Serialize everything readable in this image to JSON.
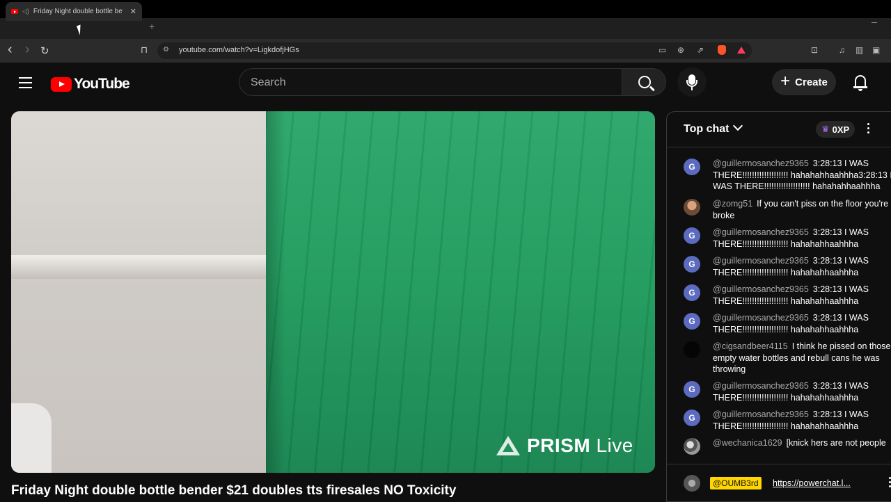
{
  "browser": {
    "tab": {
      "title": "Friday Night double bottle be",
      "close": "✕"
    },
    "new_tab": "+",
    "url": "youtube.com/watch?v=LigkdofjHGs",
    "back": "‹",
    "forward": "›",
    "reload": "↻",
    "bookmark": "⌑"
  },
  "header": {
    "logo_text": "YouTube",
    "search_placeholder": "Search",
    "create_label": "Create",
    "create_plus": "+"
  },
  "video": {
    "title": "Friday Night double bottle bender $21 doubles tts firesales NO Toxicity",
    "watermark_bold": "PRISM",
    "watermark_light": " Live"
  },
  "chat": {
    "title": "Top chat",
    "xp": "0XP",
    "messages": [
      {
        "initial": "G",
        "author": "@guillermosanchez9365",
        "text": "3:28:13 I WAS THERE!!!!!!!!!!!!!!!!!!! hahahahhaahhha3:28:13 I WAS THERE!!!!!!!!!!!!!!!!!!! hahahahhaahhha"
      },
      {
        "initial": "",
        "author": "@zomg51",
        "text": "If you can't piss on the floor you're broke"
      },
      {
        "initial": "G",
        "author": "@guillermosanchez9365",
        "text": "3:28:13 I WAS THERE!!!!!!!!!!!!!!!!!!! hahahahhaahhha"
      },
      {
        "initial": "G",
        "author": "@guillermosanchez9365",
        "text": "3:28:13 I WAS THERE!!!!!!!!!!!!!!!!!!! hahahahhaahhha"
      },
      {
        "initial": "G",
        "author": "@guillermosanchez9365",
        "text": "3:28:13 I WAS THERE!!!!!!!!!!!!!!!!!!! hahahahhaahhha"
      },
      {
        "initial": "G",
        "author": "@guillermosanchez9365",
        "text": "3:28:13 I WAS THERE!!!!!!!!!!!!!!!!!!! hahahahhaahhha"
      },
      {
        "initial": "",
        "author": "@cigsandbeer4115",
        "text": "I think he pissed on those empty water bottles and rebull cans he was throwing"
      },
      {
        "initial": "G",
        "author": "@guillermosanchez9365",
        "text": "3:28:13 I WAS THERE!!!!!!!!!!!!!!!!!!! hahahahhaahhha"
      },
      {
        "initial": "G",
        "author": "@guillermosanchez9365",
        "text": "3:28:13 I WAS THERE!!!!!!!!!!!!!!!!!!! hahahahhaahhha"
      },
      {
        "initial": "",
        "author": "@wechanica1629",
        "text": "[knick hers are not people"
      }
    ],
    "input": {
      "mention": "@OUMB3rd",
      "link": "https://powerchat.l..."
    }
  }
}
